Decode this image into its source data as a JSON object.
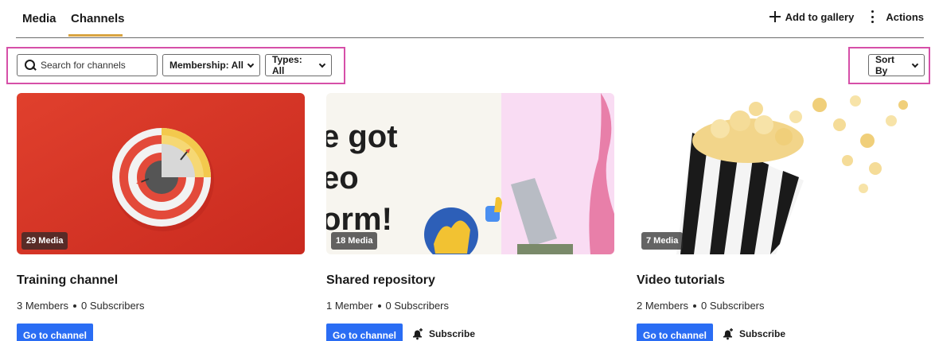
{
  "tabs": [
    {
      "label": "Media"
    },
    {
      "label": "Channels"
    }
  ],
  "header_actions": {
    "add_label": "Add to gallery",
    "actions_label": "Actions"
  },
  "filters": {
    "search_placeholder": "Search for channels",
    "membership_label": "Membership: All",
    "types_label": "Types: All",
    "sort_label": "Sort By"
  },
  "colors": {
    "primary_button": "#2a6df4",
    "tab_underline": "#d9a441",
    "highlight_outline": "#d64fa8"
  },
  "channels": [
    {
      "title": "Training channel",
      "media_count": "29 Media",
      "members": "3 Members",
      "subscribers": "0 Subscribers",
      "button_label": "Go to channel",
      "subscribe_label": ""
    },
    {
      "title": "Shared repository",
      "media_count": "18 Media",
      "members": "1 Member",
      "subscribers": "0 Subscribers",
      "button_label": "Go to channel",
      "subscribe_label": "Subscribe",
      "thumbnail_text": [
        "e got",
        "eo",
        "orm!"
      ]
    },
    {
      "title": "Video tutorials",
      "media_count": "7 Media",
      "members": "2 Members",
      "subscribers": "0 Subscribers",
      "button_label": "Go to channel",
      "subscribe_label": "Subscribe"
    }
  ]
}
